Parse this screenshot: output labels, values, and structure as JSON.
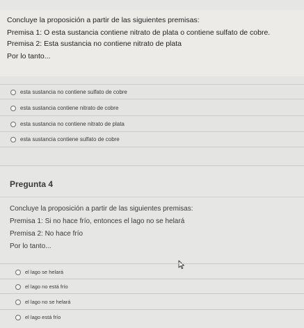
{
  "question3": {
    "prompt": "Concluye la proposición a partir de las siguientes premisas:",
    "premise1": "Premisa 1: O esta sustancia contiene nitrato de plata o contiene sulfato de cobre.",
    "premise2": "Premisa 2: Esta sustancia no contiene nitrato de plata",
    "therefore": "Por lo tanto...",
    "options": [
      "esta sustancia no contiene sulfato de cobre",
      "esta sustancia contiene nitrato de cobre",
      "esta sustancia no contiene nitrato de plata",
      "esta sustancia contiene sulfato de cobre"
    ]
  },
  "question4": {
    "heading": "Pregunta 4",
    "prompt": "Concluye la proposición a partir de las siguientes premisas:",
    "premise1": "Premisa 1: Si no hace frío, entonces el lago no se helará",
    "premise2": "Premisa 2: No hace frío",
    "therefore": "Por lo tanto...",
    "options": [
      "el lago se helará",
      "el lago no está frío",
      "el lago no se helará",
      "el lago está frío"
    ]
  }
}
